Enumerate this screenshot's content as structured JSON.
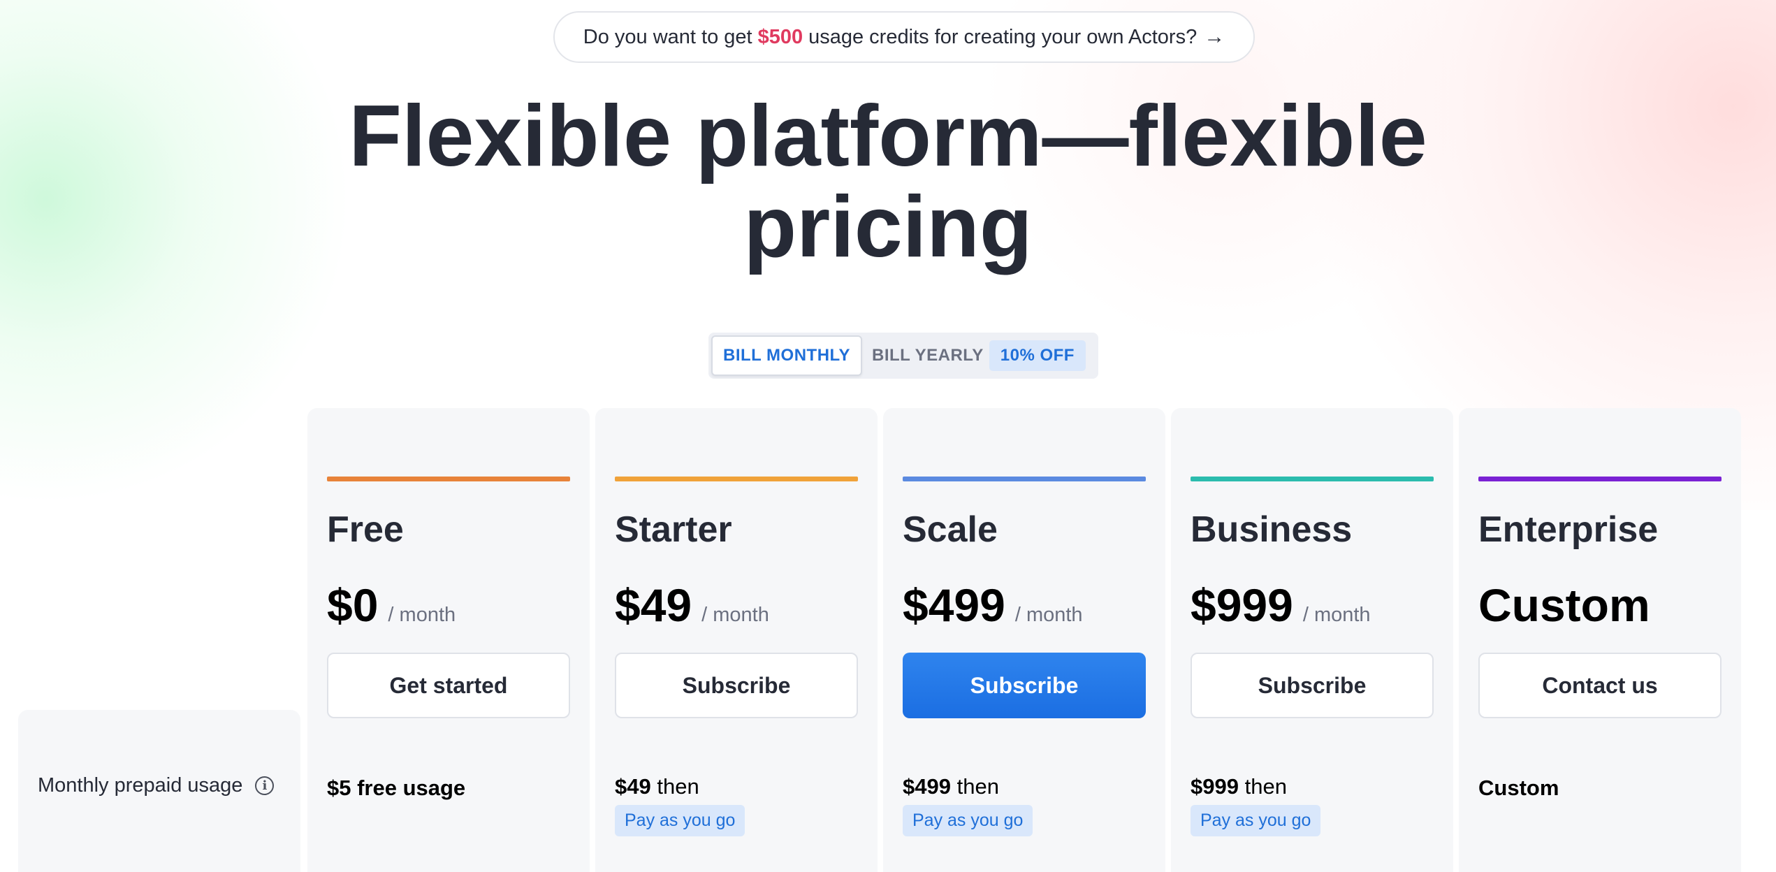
{
  "banner": {
    "text_before": "Do you want to get",
    "amount": "$500",
    "text_after": "usage credits for creating your own Actors?",
    "arrow": "→",
    "amount_color": "#e03a5f"
  },
  "hero": {
    "line1": "Flexible platform—flexible",
    "line2": "pricing"
  },
  "billing_toggle": {
    "monthly_label": "BILL MONTHLY",
    "yearly_label": "BILL YEARLY",
    "yearly_discount": "10% OFF",
    "selected": "monthly",
    "accent": "#1f6fd8"
  },
  "comparison": {
    "row_label": "Monthly prepaid usage",
    "row_info_icon": "info-icon"
  },
  "plans": [
    {
      "name": "Free",
      "price": "$0",
      "period": "/ month",
      "cta": "Get started",
      "primary": false,
      "accent": "#e8833a",
      "usage_amount": "$5 free usage",
      "usage_then": "",
      "usage_badge": ""
    },
    {
      "name": "Starter",
      "price": "$49",
      "period": "/ month",
      "cta": "Subscribe",
      "primary": false,
      "accent": "#f0a23a",
      "usage_amount": "$49",
      "usage_then": "then",
      "usage_badge": "Pay as you go"
    },
    {
      "name": "Scale",
      "price": "$499",
      "period": "/ month",
      "cta": "Subscribe",
      "primary": true,
      "accent": "#5b8ae0",
      "usage_amount": "$499",
      "usage_then": "then",
      "usage_badge": "Pay as you go"
    },
    {
      "name": "Business",
      "price": "$999",
      "period": "/ month",
      "cta": "Subscribe",
      "primary": false,
      "accent": "#2bbcae",
      "usage_amount": "$999",
      "usage_then": "then",
      "usage_badge": "Pay as you go"
    },
    {
      "name": "Enterprise",
      "price": "Custom",
      "period": "",
      "cta": "Contact us",
      "primary": false,
      "accent": "#7a22d4",
      "usage_amount": "Custom",
      "usage_then": "",
      "usage_badge": ""
    }
  ]
}
